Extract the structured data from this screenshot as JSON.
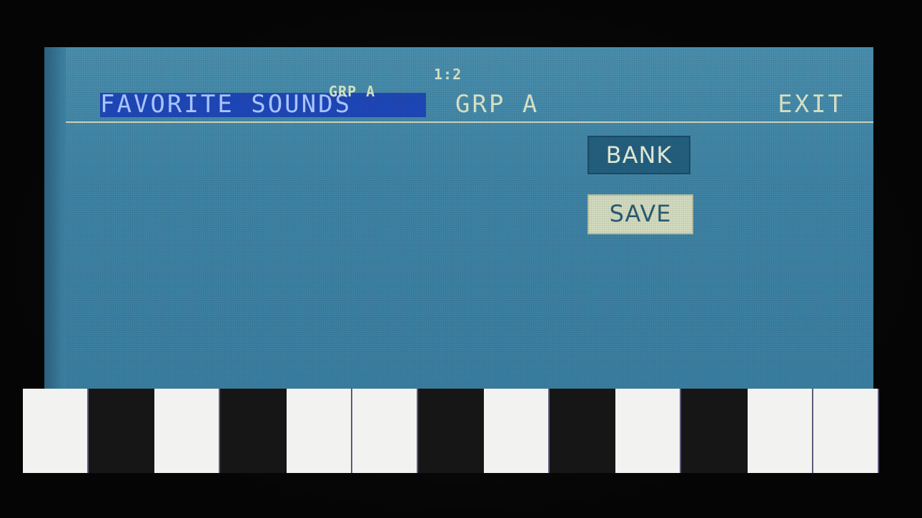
{
  "header": {
    "page_indicator": "1:2",
    "group_small": "GRP A",
    "title": "FAVORITE SOUNDS",
    "group_big": "GRP A",
    "exit_label": "EXIT"
  },
  "buttons": {
    "bank_label": "BANK",
    "save_label": "SAVE"
  },
  "keyboard": {
    "keys": [
      "white",
      "black",
      "white",
      "black",
      "white",
      "white",
      "black",
      "white",
      "black",
      "white",
      "black",
      "white",
      "white"
    ]
  },
  "colors": {
    "lcd_background": "#3f84a6",
    "title_highlight": "#1f48b8",
    "text_light": "#dce6c9",
    "white_key": "#f2f3f1",
    "black_key": "#161616"
  }
}
